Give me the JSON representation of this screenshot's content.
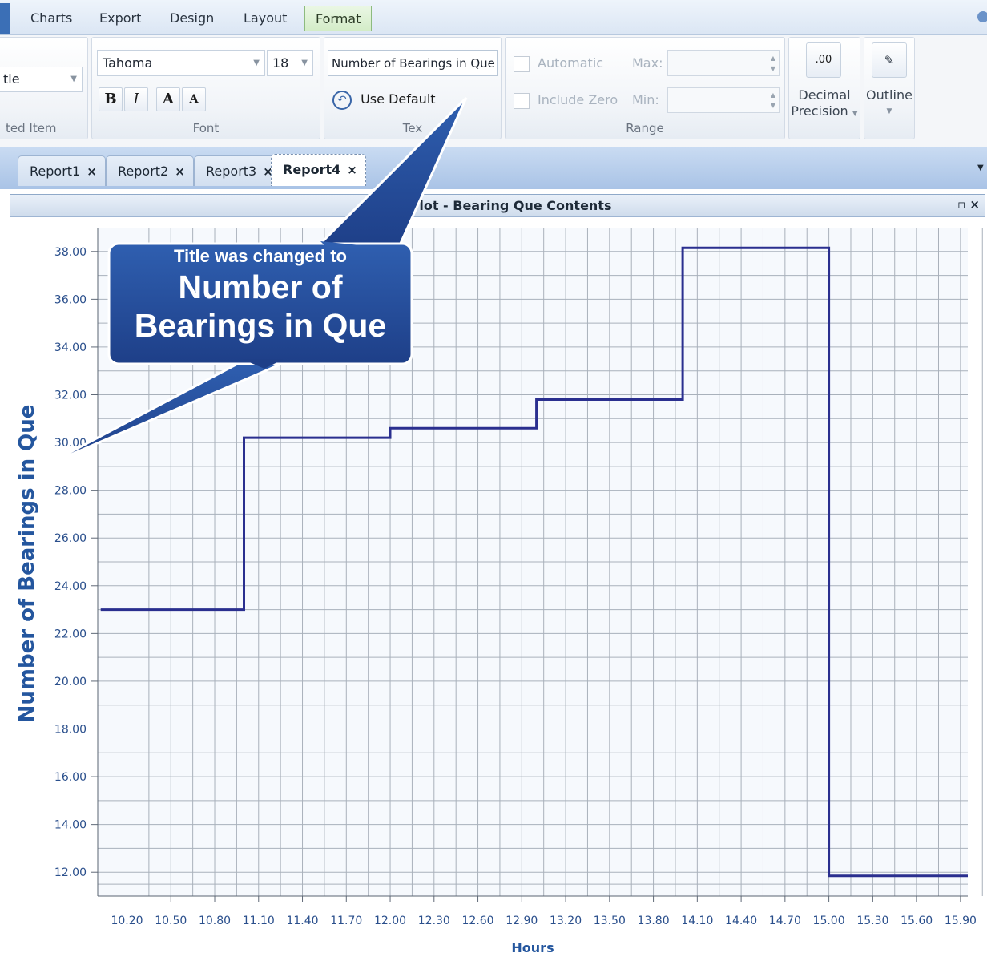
{
  "ribbon": {
    "tabs": [
      {
        "label": "Charts"
      },
      {
        "label": "Export"
      },
      {
        "label": "Design"
      },
      {
        "label": "Layout"
      },
      {
        "label": "Format"
      }
    ],
    "selected_item": {
      "combo_value": "tle",
      "group_label": "ted Item"
    },
    "font": {
      "family": "Tahoma",
      "size": "18",
      "bold_label": "B",
      "italic_label": "I",
      "grow_label": "A",
      "shrink_label": "A",
      "group_label": "Font"
    },
    "text": {
      "title_value": "Number of Bearings in Que",
      "use_default_label": "Use Default",
      "group_label": "Tex"
    },
    "range": {
      "automatic_label": "Automatic",
      "include_zero_label": "Include Zero",
      "max_label": "Max:",
      "min_label": "Min:",
      "group_label": "Range"
    },
    "decimal_precision": {
      "icon_text": ".00",
      "label_line1": "Decimal",
      "label_line2": "Precision"
    },
    "outline": {
      "label": "Outline"
    }
  },
  "doc_tabs": [
    {
      "label": "Report1"
    },
    {
      "label": "Report2"
    },
    {
      "label": "Report3"
    },
    {
      "label": "Report4"
    }
  ],
  "panel": {
    "title": "me Plot - Bearing Que Contents",
    "controls": "▫ ×"
  },
  "callout": {
    "small_text": "Title was changed to",
    "big_line1": "Number of",
    "big_line2": "Bearings in Que"
  },
  "chart_data": {
    "type": "line",
    "step": true,
    "xlabel": "Hours",
    "ylabel": "Number of Bearings in Que",
    "xlim": [
      10.0,
      15.95
    ],
    "ylim": [
      11.0,
      39.0
    ],
    "x_ticks": [
      "10.20",
      "10.50",
      "10.80",
      "11.10",
      "11.40",
      "11.70",
      "12.00",
      "12.30",
      "12.60",
      "12.90",
      "13.20",
      "13.50",
      "13.80",
      "14.10",
      "14.40",
      "14.70",
      "15.00",
      "15.30",
      "15.60",
      "15.90"
    ],
    "y_ticks": [
      "12.00",
      "14.00",
      "16.00",
      "18.00",
      "20.00",
      "22.00",
      "24.00",
      "26.00",
      "28.00",
      "30.00",
      "32.00",
      "34.00",
      "36.00",
      "38.00"
    ],
    "grid": true,
    "series": [
      {
        "color": "#2a2f8f",
        "points": [
          [
            10.02,
            23.0
          ],
          [
            11.0,
            23.0
          ],
          [
            11.0,
            30.2
          ],
          [
            12.0,
            30.2
          ],
          [
            12.0,
            30.6
          ],
          [
            13.0,
            30.6
          ],
          [
            13.0,
            31.8
          ],
          [
            14.0,
            31.8
          ],
          [
            14.0,
            38.15
          ],
          [
            15.0,
            38.15
          ],
          [
            15.0,
            11.85
          ],
          [
            15.95,
            11.85
          ]
        ]
      }
    ]
  }
}
